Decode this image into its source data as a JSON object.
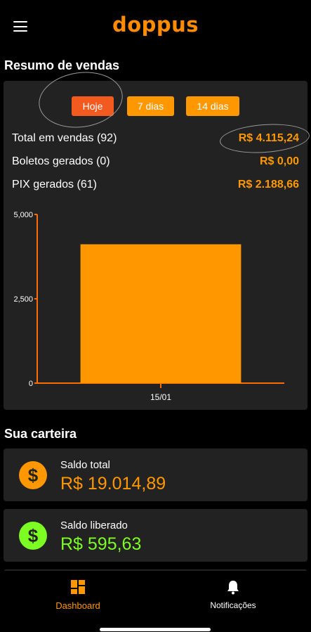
{
  "app": {
    "logo": "doppus"
  },
  "header": {
    "menu_icon": "hamburger-menu-icon"
  },
  "sales_summary": {
    "title": "Resumo de vendas",
    "filters": [
      {
        "label": "Hoje",
        "active": true
      },
      {
        "label": "7 dias",
        "active": false
      },
      {
        "label": "14 dias",
        "active": false
      }
    ],
    "rows": [
      {
        "label": "Total em vendas (92)",
        "value": "R$ 4.115,24"
      },
      {
        "label": "Boletos gerados (0)",
        "value": "R$ 0,00"
      },
      {
        "label": "PIX gerados (61)",
        "value": "R$ 2.188,66"
      }
    ]
  },
  "chart_data": {
    "type": "bar",
    "categories": [
      "15/01"
    ],
    "values": [
      4115.24
    ],
    "ylim": [
      0,
      5000
    ],
    "yticks": [
      0,
      2500,
      5000
    ],
    "ytick_labels": [
      "0",
      "2,500",
      "5,000"
    ],
    "title": "",
    "xlabel": "",
    "ylabel": "",
    "bar_color": "#ff9800",
    "axis_color": "#ff6d00",
    "grid": false
  },
  "wallet": {
    "title": "Sua carteira",
    "items": [
      {
        "label": "Saldo total",
        "value": "R$ 19.014,89",
        "color": "#ff9800",
        "icon": "dollar-coin-icon"
      },
      {
        "label": "Saldo liberado",
        "value": "R$ 595,63",
        "color": "#7cfc22",
        "icon": "dollar-coin-icon"
      }
    ]
  },
  "bottom_nav": {
    "items": [
      {
        "label": "Dashboard",
        "icon": "dashboard-grid-icon",
        "active": true
      },
      {
        "label": "Notificações",
        "icon": "bell-icon",
        "active": false
      }
    ]
  },
  "colors": {
    "accent": "#ff9800",
    "active_chip": "#f25a1f",
    "card_bg": "#222222",
    "positive": "#7cfc22"
  }
}
